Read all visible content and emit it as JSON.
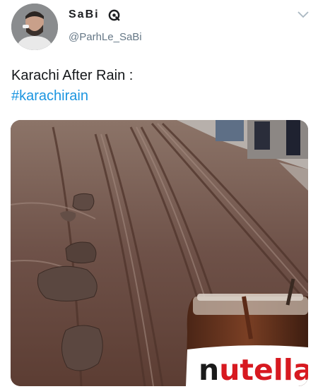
{
  "tweet": {
    "author": {
      "display_name": "SaBi",
      "handle": "@ParhLe_SaBi"
    },
    "text_line1": "Karachi After Rain :",
    "hashtag": "#karachirain",
    "media": {
      "jar_label": "nutella"
    }
  },
  "icons": [
    "avatar",
    "verified-badge-icon",
    "chevron-down-icon"
  ],
  "colors": {
    "hashtag": "#1b95e0",
    "handle": "#657786",
    "text": "#14171a",
    "mud": "#6b5046",
    "jar_red": "#d71920"
  }
}
